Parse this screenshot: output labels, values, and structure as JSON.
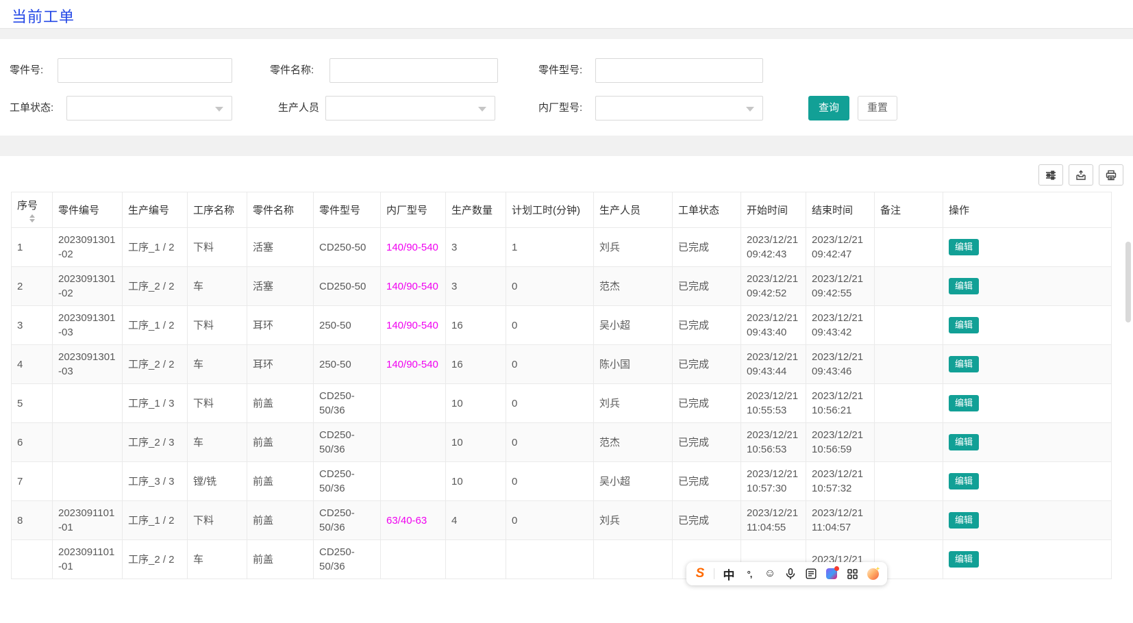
{
  "page": {
    "title": "当前工单"
  },
  "colors": {
    "title_blue": "#2448e6",
    "accent_teal": "#12a096",
    "link_magenta": "#f000f0",
    "sogou_orange": "#ff6a00"
  },
  "filters": {
    "part_no_label": "零件号:",
    "part_name_label": "零件名称:",
    "part_model_label": "零件型号:",
    "order_status_label": "工单状态:",
    "producer_label": "生产人员",
    "factory_model_label": "内厂型号:",
    "part_no_value": "",
    "part_name_value": "",
    "part_model_value": "",
    "order_status_value": "",
    "producer_value": "",
    "factory_model_value": "",
    "query_button": "查询",
    "reset_button": "重置"
  },
  "toolbar": {
    "icons": [
      "column-filter-icon",
      "export-icon",
      "print-icon"
    ]
  },
  "table": {
    "columns": [
      "序号",
      "零件编号",
      "生产编号",
      "工序名称",
      "零件名称",
      "零件型号",
      "内厂型号",
      "生产数量",
      "计划工时(分钟)",
      "生产人员",
      "工单状态",
      "开始时间",
      "结束时间",
      "备注",
      "操作"
    ],
    "edit_button": "编辑",
    "magenta_column_index": 6,
    "rows": [
      {
        "cells": [
          "1",
          "2023091301-02",
          "工序_1 / 2",
          "下料",
          "活塞",
          "CD250-50",
          "140/90-540",
          "3",
          "1",
          "刘兵",
          "已完成",
          "2023/12/21 09:42:43",
          "2023/12/21 09:42:47",
          ""
        ]
      },
      {
        "cells": [
          "2",
          "2023091301-02",
          "工序_2 / 2",
          "车",
          "活塞",
          "CD250-50",
          "140/90-540",
          "3",
          "0",
          "范杰",
          "已完成",
          "2023/12/21 09:42:52",
          "2023/12/21 09:42:55",
          ""
        ]
      },
      {
        "cells": [
          "3",
          "2023091301-03",
          "工序_1 / 2",
          "下料",
          "耳环",
          "250-50",
          "140/90-540",
          "16",
          "0",
          "吴小超",
          "已完成",
          "2023/12/21 09:43:40",
          "2023/12/21 09:43:42",
          ""
        ]
      },
      {
        "cells": [
          "4",
          "2023091301-03",
          "工序_2 / 2",
          "车",
          "耳环",
          "250-50",
          "140/90-540",
          "16",
          "0",
          "陈小国",
          "已完成",
          "2023/12/21 09:43:44",
          "2023/12/21 09:43:46",
          ""
        ]
      },
      {
        "cells": [
          "5",
          "",
          "工序_1 / 3",
          "下料",
          "前盖",
          "CD250-50/36",
          "",
          "10",
          "0",
          "刘兵",
          "已完成",
          "2023/12/21 10:55:53",
          "2023/12/21 10:56:21",
          ""
        ]
      },
      {
        "cells": [
          "6",
          "",
          "工序_2 / 3",
          "车",
          "前盖",
          "CD250-50/36",
          "",
          "10",
          "0",
          "范杰",
          "已完成",
          "2023/12/21 10:56:53",
          "2023/12/21 10:56:59",
          ""
        ]
      },
      {
        "cells": [
          "7",
          "",
          "工序_3 / 3",
          "镗/铣",
          "前盖",
          "CD250-50/36",
          "",
          "10",
          "0",
          "吴小超",
          "已完成",
          "2023/12/21 10:57:30",
          "2023/12/21 10:57:32",
          ""
        ]
      },
      {
        "cells": [
          "8",
          "2023091101-01",
          "工序_1 / 2",
          "下料",
          "前盖",
          "CD250-50/36",
          "63/40-63",
          "4",
          "0",
          "刘兵",
          "已完成",
          "2023/12/21 11:04:55",
          "2023/12/21 11:04:57",
          ""
        ]
      },
      {
        "cells": [
          "",
          "2023091101-01",
          "工序_2 / 2",
          "车",
          "前盖",
          "CD250-50/36",
          "",
          "",
          "",
          "",
          "",
          "",
          "2023/12/21",
          ""
        ]
      }
    ]
  },
  "ime_toolbar": {
    "logo_glyph": "S",
    "chinese_mode_glyph": "中",
    "punctuation_glyph": "°,",
    "emoji_glyph": "☺",
    "icons": [
      "sogou-logo",
      "chinese-mode-icon",
      "punctuation-icon",
      "emoji-icon",
      "microphone-icon",
      "handwriting-pad-icon",
      "skin-icon",
      "toolbox-icon",
      "assistant-icon"
    ]
  }
}
